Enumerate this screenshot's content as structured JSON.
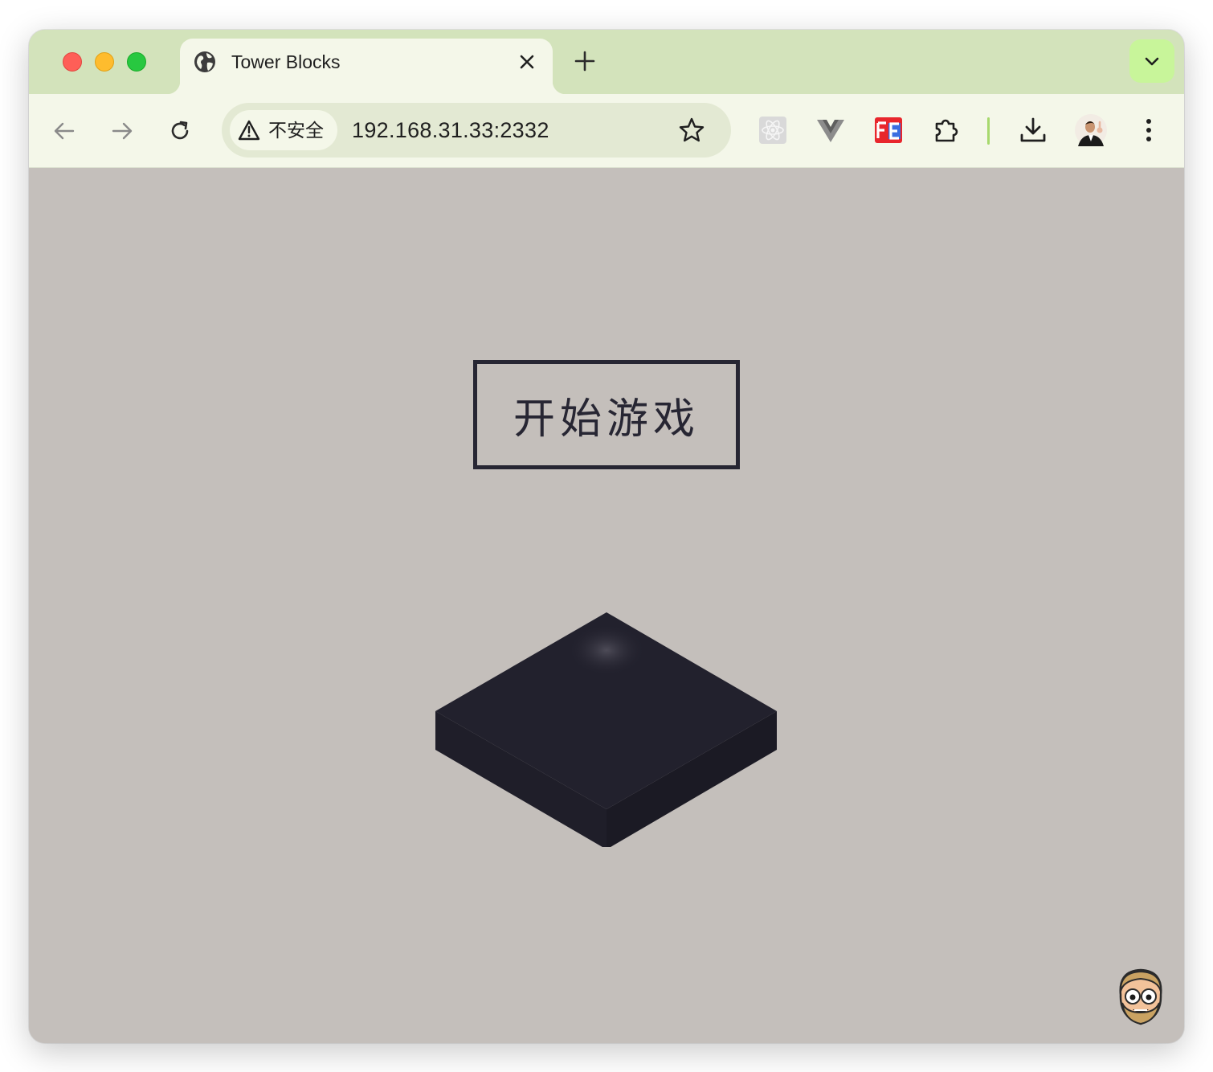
{
  "browser": {
    "tab": {
      "title": "Tower Blocks",
      "favicon": "globe-icon"
    },
    "address_bar": {
      "security_label": "不安全",
      "url": "192.168.31.33:2332"
    },
    "extensions": [
      "react-devtools-icon",
      "vue-devtools-icon",
      "fe-helper-icon",
      "extensions-puzzle-icon"
    ],
    "colors": {
      "tabstrip": "#d3e3bb",
      "toolbar": "#f4f7e9",
      "omnibox": "#e3e9d3",
      "tab_search_accent": "#c8f59a"
    }
  },
  "page": {
    "background": "#c4bfbb",
    "start_button_label": "开始游戏",
    "block_color": "#22212d"
  }
}
